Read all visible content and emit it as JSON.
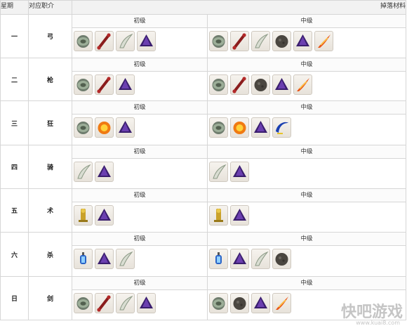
{
  "header": {
    "col_day": "星期",
    "col_job": "对应职介",
    "col_drops": "掉落材料"
  },
  "tiers": {
    "basic": "初级",
    "mid": "中级"
  },
  "rows": [
    {
      "day": "一",
      "job": "弓",
      "basic": [
        "jade-disc-icon",
        "bone-icon",
        "claw-icon",
        "purple-crystal-icon"
      ],
      "mid": [
        "jade-disc-icon",
        "bone-icon",
        "claw-icon",
        "dark-ore-icon",
        "purple-crystal-icon",
        "phoenix-feather-icon"
      ]
    },
    {
      "day": "二",
      "job": "枪",
      "basic": [
        "jade-disc-icon",
        "bone-icon",
        "purple-crystal-icon"
      ],
      "mid": [
        "jade-disc-icon",
        "bone-icon",
        "dark-ore-icon",
        "purple-crystal-icon",
        "phoenix-feather-icon"
      ]
    },
    {
      "day": "三",
      "job": "狂",
      "basic": [
        "jade-disc-icon",
        "fire-orb-icon",
        "purple-crystal-icon"
      ],
      "mid": [
        "jade-disc-icon",
        "fire-orb-icon",
        "purple-crystal-icon",
        "crescent-icon"
      ]
    },
    {
      "day": "四",
      "job": "骑",
      "basic": [
        "claw-icon",
        "purple-crystal-icon"
      ],
      "mid": [
        "claw-icon",
        "purple-crystal-icon"
      ]
    },
    {
      "day": "五",
      "job": "术",
      "basic": [
        "golden-idol-icon",
        "purple-crystal-icon"
      ],
      "mid": [
        "golden-idol-icon",
        "purple-crystal-icon"
      ]
    },
    {
      "day": "六",
      "job": "杀",
      "basic": [
        "lantern-icon",
        "purple-crystal-icon",
        "claw-icon"
      ],
      "mid": [
        "lantern-icon",
        "purple-crystal-icon",
        "claw-icon",
        "dark-ore-icon"
      ]
    },
    {
      "day": "日",
      "job": "剑",
      "basic": [
        "jade-disc-icon",
        "bone-icon",
        "claw-icon",
        "purple-crystal-icon"
      ],
      "mid": [
        "jade-disc-icon",
        "dark-ore-icon",
        "purple-crystal-icon",
        "phoenix-feather-icon"
      ]
    }
  ],
  "watermark": {
    "main": "快吧游戏",
    "sub": "www.kuai8.com"
  }
}
